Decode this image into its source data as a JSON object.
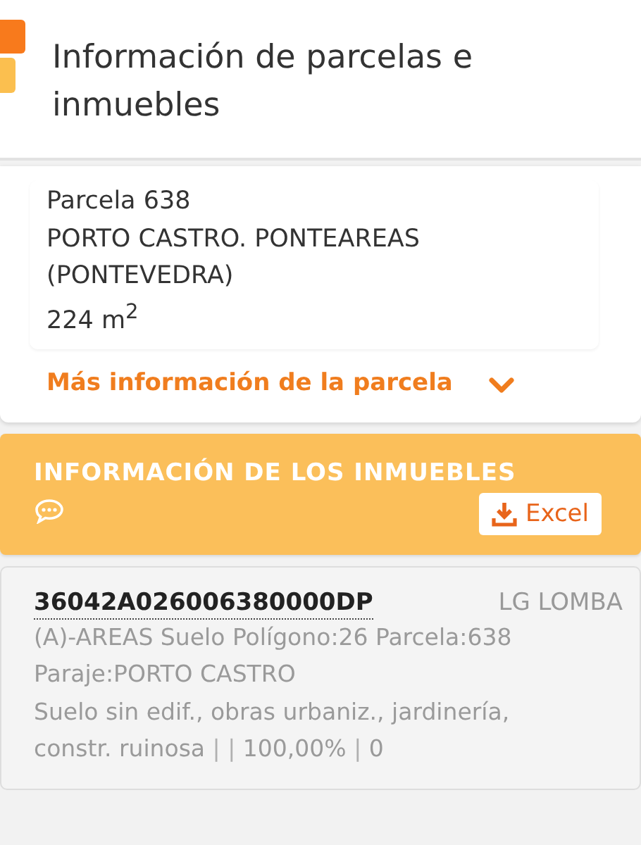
{
  "header": {
    "title": "Información de parcelas e inmuebles"
  },
  "parcel": {
    "name": "Parcela 638",
    "address": "PORTO CASTRO. PONTEAREAS (PONTEVEDRA)",
    "area": "224 m$^{2}$",
    "more_link": "Más información de la parcela",
    "expanded": false
  },
  "properties_section": {
    "title": "INFORMACIÓN DE LOS INMUEBLES",
    "export_button": "Excel"
  },
  "properties": [
    {
      "reference": "36042A026006380000DP",
      "location": "LG LOMBA",
      "lines": [
        "(A)-AREAS Suelo Polígono:26 Parcela:638",
        "Paraje:PORTO CASTRO"
      ],
      "details": [
        {
          "kind": "value",
          "text": "Suelo sin edif., obras urbaniz., jardinería, constr. ruinosa"
        },
        {
          "kind": "separator",
          "text": "|"
        },
        {
          "kind": "separator",
          "text": "|"
        },
        {
          "kind": "value",
          "text": "100,00%"
        },
        {
          "kind": "separator",
          "text": "|"
        },
        {
          "kind": "value",
          "text": "0"
        }
      ]
    }
  ]
}
